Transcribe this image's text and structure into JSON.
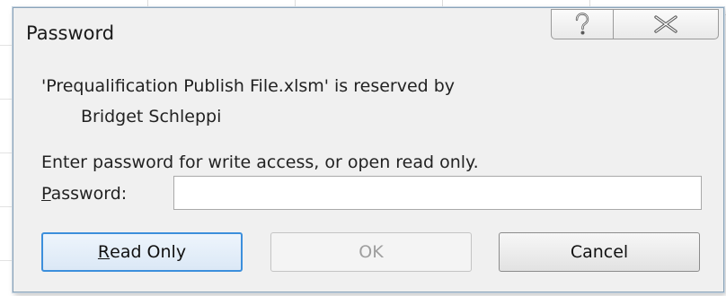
{
  "dialog": {
    "title": "Password",
    "message_line1": "'Prequalification Publish File.xlsm' is reserved by",
    "message_line2": "Bridget Schleppi",
    "instruction": "Enter password for write access, or open read only.",
    "password_label_mnemonic": "P",
    "password_label_rest": "assword:",
    "password_value": "",
    "buttons": {
      "read_only_mnemonic": "R",
      "read_only_rest": "ead Only",
      "ok": "OK",
      "cancel": "Cancel"
    }
  },
  "icons": {
    "help": "help-icon",
    "close": "close-icon"
  },
  "colors": {
    "focus_border": "#3c8fdc",
    "disabled_text": "#9e9e9e",
    "dialog_bg": "#f0f0f0"
  }
}
